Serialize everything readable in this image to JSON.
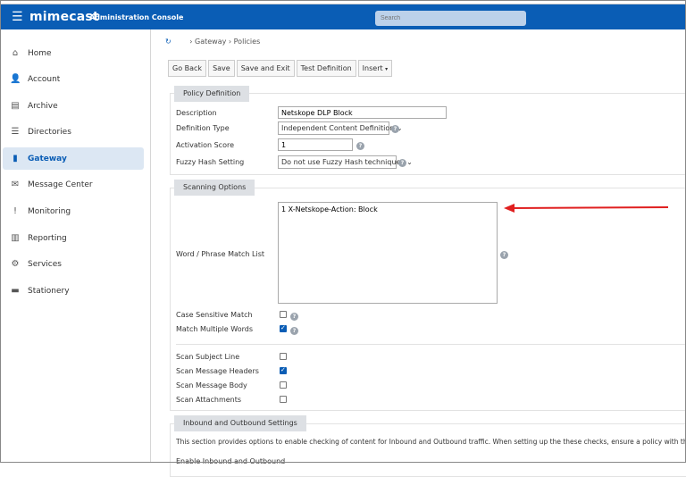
{
  "header": {
    "brand": "mimecast",
    "title": "Administration Console",
    "search_placeholder": "Search"
  },
  "sidebar": {
    "items": [
      {
        "label": "Home",
        "icon": "home-icon",
        "glyph": "⌂"
      },
      {
        "label": "Account",
        "icon": "account-icon",
        "glyph": "👤"
      },
      {
        "label": "Archive",
        "icon": "archive-icon",
        "glyph": "▤"
      },
      {
        "label": "Directories",
        "icon": "directories-icon",
        "glyph": "☰"
      },
      {
        "label": "Gateway",
        "icon": "gateway-icon",
        "glyph": "▮"
      },
      {
        "label": "Message Center",
        "icon": "message-center-icon",
        "glyph": "✉"
      },
      {
        "label": "Monitoring",
        "icon": "monitoring-icon",
        "glyph": "!"
      },
      {
        "label": "Reporting",
        "icon": "reporting-icon",
        "glyph": "▥"
      },
      {
        "label": "Services",
        "icon": "services-icon",
        "glyph": "⚙"
      },
      {
        "label": "Stationery",
        "icon": "stationery-icon",
        "glyph": "▬"
      }
    ],
    "active": "Gateway"
  },
  "breadcrumb": [
    "Gateway",
    "Policies"
  ],
  "toolbar": {
    "go_back": "Go Back",
    "save": "Save",
    "save_exit": "Save and Exit",
    "test": "Test Definition",
    "insert": "Insert"
  },
  "policy": {
    "section": "Policy Definition",
    "description_label": "Description",
    "description": "Netskope DLP Block",
    "type_label": "Definition Type",
    "type": "Independent Content Definition",
    "score_label": "Activation Score",
    "score": "1",
    "fuzzy_label": "Fuzzy Hash Setting",
    "fuzzy": "Do not use Fuzzy Hash techniques"
  },
  "scanning": {
    "section": "Scanning Options",
    "match_label": "Word / Phrase Match List",
    "match_list": "1 X-Netskope-Action: Block",
    "options": [
      {
        "label": "Case Sensitive Match",
        "checked": false,
        "help": true
      },
      {
        "label": "Match Multiple Words",
        "checked": true,
        "help": true
      },
      {
        "label": "Scan Subject Line",
        "checked": false
      },
      {
        "label": "Scan Message Headers",
        "checked": true
      },
      {
        "label": "Scan Message Body",
        "checked": false
      },
      {
        "label": "Scan Attachments",
        "checked": false
      }
    ]
  },
  "inbound": {
    "section": "Inbound and Outbound Settings",
    "note": "This section provides options to enable checking of content for Inbound and Outbound traffic. When setting up the these checks, ensure a policy with the correct",
    "enable_label": "Enable Inbound and Outbound"
  },
  "colors": {
    "brand": "#0a5db5",
    "arrow": "#e02020"
  }
}
